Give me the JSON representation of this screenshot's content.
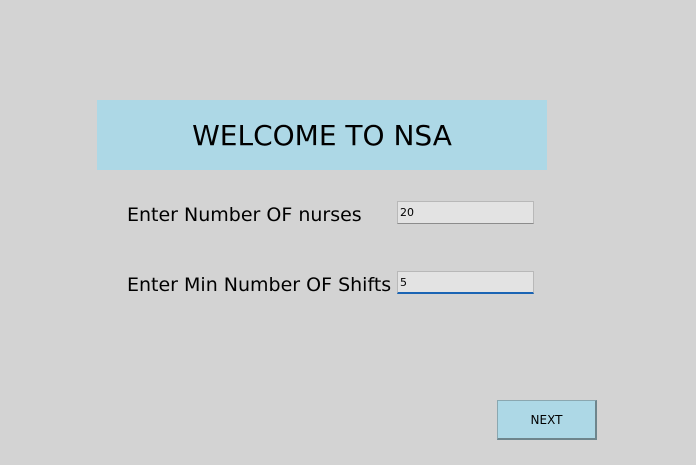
{
  "header": {
    "title": "WELCOME TO NSA"
  },
  "form": {
    "nurses_label": "Enter Number OF nurses",
    "nurses_value": "20",
    "shifts_label": "Enter Min Number OF Shifts",
    "shifts_value": "5"
  },
  "actions": {
    "next_label": "NEXT"
  },
  "colors": {
    "background": "#d3d3d3",
    "accent": "#add8e6",
    "focus_underline": "#1a64b4"
  }
}
